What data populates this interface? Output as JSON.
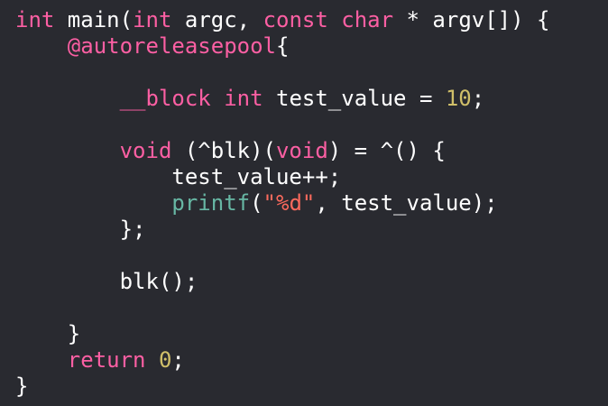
{
  "editor": {
    "lines": [
      {
        "indent": 0,
        "tokens": [
          {
            "text": "int",
            "kind": "kw"
          },
          {
            "text": " main(",
            "kind": "plain"
          },
          {
            "text": "int",
            "kind": "kw"
          },
          {
            "text": " argc, ",
            "kind": "plain"
          },
          {
            "text": "const",
            "kind": "kw"
          },
          {
            "text": " ",
            "kind": "plain"
          },
          {
            "text": "char",
            "kind": "kw"
          },
          {
            "text": " * argv[]) {",
            "kind": "plain"
          }
        ]
      },
      {
        "indent": 4,
        "tokens": [
          {
            "text": "@autoreleasepool",
            "kind": "kw"
          },
          {
            "text": "{",
            "kind": "plain"
          }
        ]
      },
      {
        "indent": 0,
        "tokens": []
      },
      {
        "indent": 8,
        "tokens": [
          {
            "text": "__block",
            "kind": "kw"
          },
          {
            "text": " ",
            "kind": "plain"
          },
          {
            "text": "int",
            "kind": "kw"
          },
          {
            "text": " test_value = ",
            "kind": "plain"
          },
          {
            "text": "10",
            "kind": "num"
          },
          {
            "text": ";",
            "kind": "plain"
          }
        ]
      },
      {
        "indent": 0,
        "tokens": []
      },
      {
        "indent": 8,
        "tokens": [
          {
            "text": "void",
            "kind": "kw"
          },
          {
            "text": " (^blk)(",
            "kind": "plain"
          },
          {
            "text": "void",
            "kind": "kw"
          },
          {
            "text": ") = ^() {",
            "kind": "plain"
          }
        ]
      },
      {
        "indent": 12,
        "tokens": [
          {
            "text": "test_value++;",
            "kind": "plain"
          }
        ]
      },
      {
        "indent": 12,
        "tokens": [
          {
            "text": "printf",
            "kind": "fn"
          },
          {
            "text": "(",
            "kind": "plain"
          },
          {
            "text": "\"%d\"",
            "kind": "str"
          },
          {
            "text": ", test_value);",
            "kind": "plain"
          }
        ]
      },
      {
        "indent": 8,
        "tokens": [
          {
            "text": "};",
            "kind": "plain"
          }
        ]
      },
      {
        "indent": 0,
        "tokens": []
      },
      {
        "indent": 8,
        "tokens": [
          {
            "text": "blk();",
            "kind": "plain"
          }
        ]
      },
      {
        "indent": 0,
        "tokens": []
      },
      {
        "indent": 4,
        "tokens": [
          {
            "text": "}",
            "kind": "plain"
          }
        ]
      },
      {
        "indent": 4,
        "tokens": [
          {
            "text": "return",
            "kind": "kw"
          },
          {
            "text": " ",
            "kind": "plain"
          },
          {
            "text": "0",
            "kind": "num"
          },
          {
            "text": ";",
            "kind": "plain"
          }
        ]
      },
      {
        "indent": 0,
        "tokens": [
          {
            "text": "}",
            "kind": "plain"
          }
        ]
      }
    ]
  },
  "colors": {
    "background": "#292a30",
    "keyword": "#fc5fa3",
    "number": "#d0bf69",
    "function": "#67b7a4",
    "string": "#fc6a5d",
    "plain": "#ffffff"
  }
}
